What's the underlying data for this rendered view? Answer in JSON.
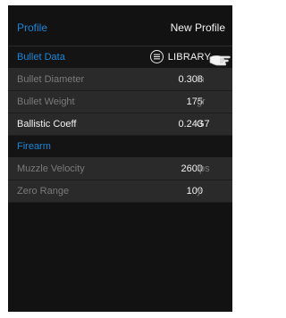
{
  "colors": {
    "accent": "#1a86d8",
    "background": "#121212",
    "row": "#2a2a2a",
    "muted_text": "#7a7a7a",
    "text": "#f2f2f2"
  },
  "profile": {
    "label": "Profile",
    "value": "New Profile"
  },
  "bullet_section": {
    "title": "Bullet Data",
    "library_label": "LIBRARY",
    "library_icon": "menu-circle-icon",
    "hint_icon": "pointing-hand-icon"
  },
  "bullet_rows": [
    {
      "label": "Bullet Diameter",
      "value": "0.308",
      "unit": "in"
    },
    {
      "label": "Bullet Weight",
      "value": "175",
      "unit": "gr"
    },
    {
      "label": "Ballistic Coeff",
      "value": "0.243",
      "unit": "G7"
    }
  ],
  "firearm_section": {
    "title": "Firearm"
  },
  "firearm_rows": [
    {
      "label": "Muzzle Velocity",
      "value": "2600",
      "unit": "fps"
    },
    {
      "label": "Zero Range",
      "value": "100",
      "unit": "y"
    }
  ]
}
